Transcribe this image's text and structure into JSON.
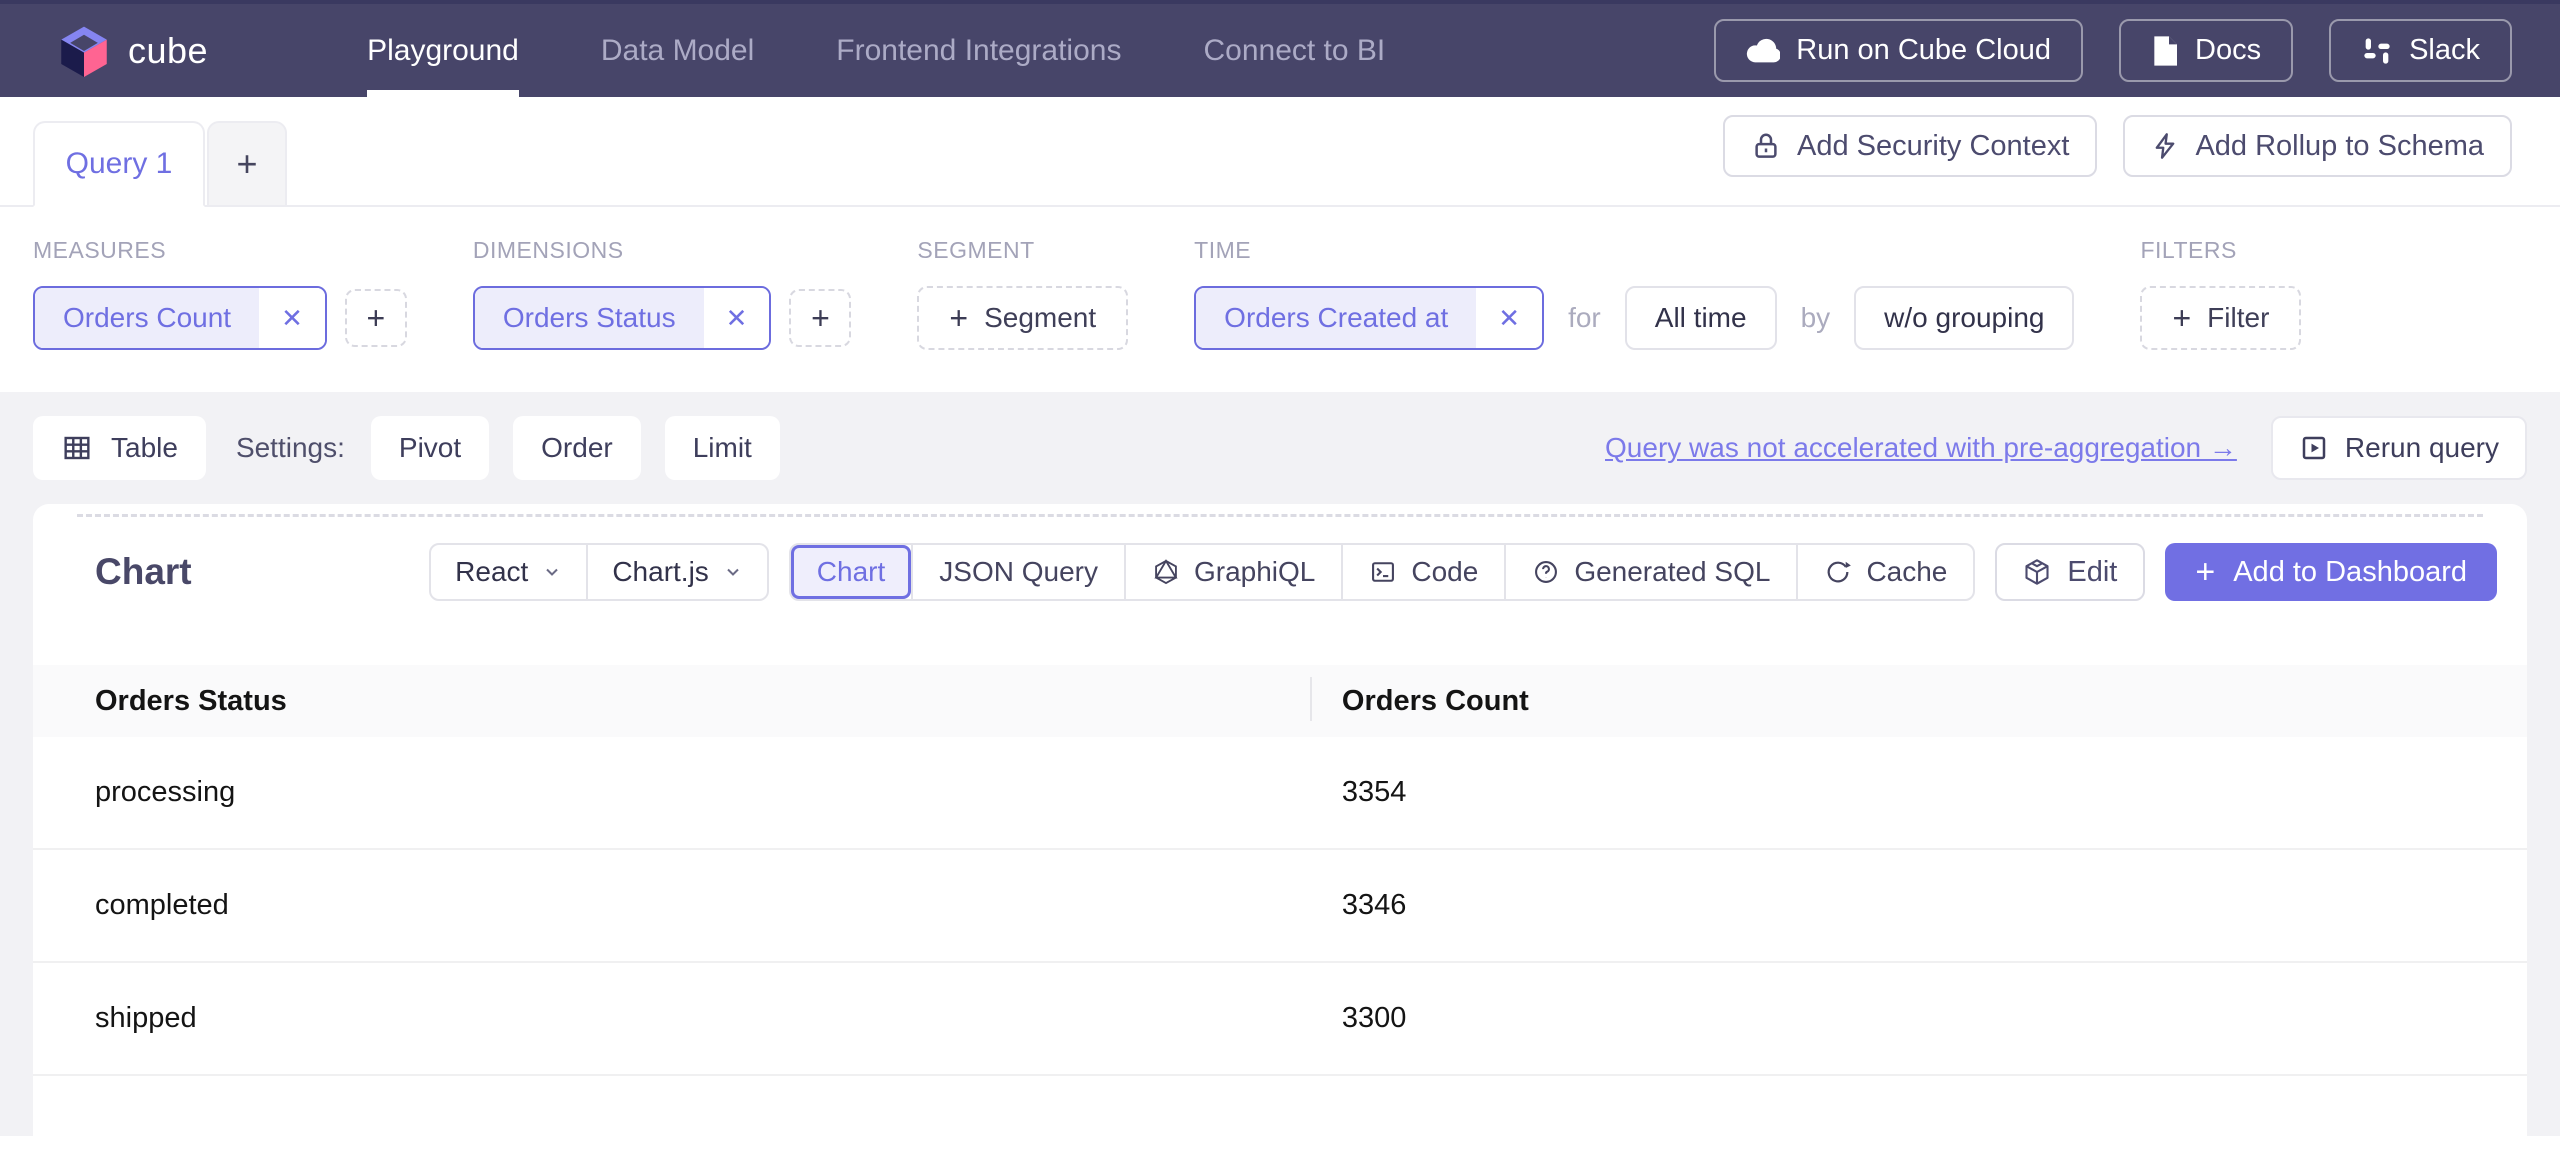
{
  "glyphs": {
    "plus": "+",
    "close": "✕"
  },
  "colors": {
    "accent": "#6F6FE2",
    "nav_bg": "#474569",
    "brand_pink": "#FF6492",
    "brand_lilac": "#8585F2",
    "brand_navy": "#1B1B4B",
    "add_to_dashboard_bg": "#716FE3"
  },
  "header": {
    "brand": "cube",
    "nav": [
      {
        "label": "Playground"
      },
      {
        "label": "Data Model"
      },
      {
        "label": "Frontend Integrations"
      },
      {
        "label": "Connect to BI"
      }
    ],
    "actions": [
      {
        "label": "Run on Cube Cloud"
      },
      {
        "label": "Docs"
      },
      {
        "label": "Slack"
      }
    ]
  },
  "tabs": {
    "items": [
      {
        "label": "Query 1"
      }
    ],
    "add_label": "+",
    "actions": [
      {
        "label": "Add Security Context"
      },
      {
        "label": "Add Rollup to Schema"
      }
    ]
  },
  "query_builder": {
    "measures": {
      "label": "MEASURES",
      "chip": "Orders Count"
    },
    "dimensions": {
      "label": "DIMENSIONS",
      "chip": "Orders Status"
    },
    "segment": {
      "label": "SEGMENT",
      "add_label": "Segment"
    },
    "time": {
      "label": "TIME",
      "chip": "Orders Created at",
      "for_label": "for",
      "range": "All time",
      "by_label": "by",
      "grouping": "w/o grouping"
    },
    "filters": {
      "label": "FILTERS",
      "add_label": "Filter"
    }
  },
  "settings_bar": {
    "table_label": "Table",
    "settings_label": "Settings:",
    "pivot_label": "Pivot",
    "order_label": "Order",
    "limit_label": "Limit",
    "link": "Query was not accelerated with pre-aggregation →",
    "rerun_label": "Rerun query"
  },
  "chart_panel": {
    "title": "Chart",
    "framework": "React",
    "library": "Chart.js",
    "tabs": [
      {
        "label": "Chart"
      },
      {
        "label": "JSON Query"
      },
      {
        "label": "GraphiQL"
      },
      {
        "label": "Code"
      },
      {
        "label": "Generated SQL"
      },
      {
        "label": "Cache"
      }
    ],
    "edit_label": "Edit",
    "add_to_dashboard_label": "Add to Dashboard"
  },
  "chart_data": {
    "type": "table",
    "columns": [
      "Orders Status",
      "Orders Count"
    ],
    "rows": [
      [
        "processing",
        "3354"
      ],
      [
        "completed",
        "3346"
      ],
      [
        "shipped",
        "3300"
      ]
    ]
  }
}
